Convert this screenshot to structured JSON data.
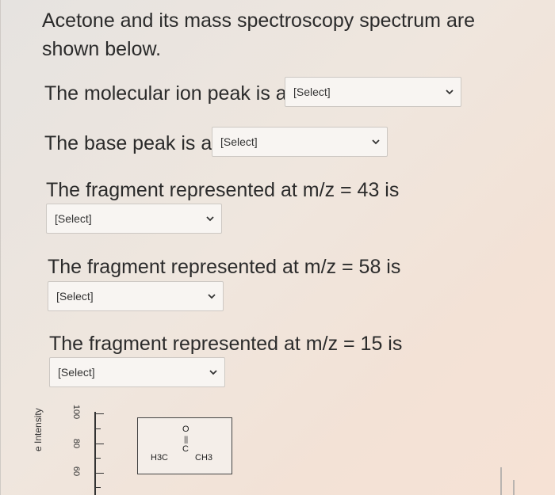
{
  "intro": "Acetone and its mass spectroscopy spectrum are shown below.",
  "questions": [
    {
      "prefix": "The molecular ion peak is at",
      "selected": "[Select]"
    },
    {
      "prefix": "The base peak is at",
      "selected": "[Select]"
    },
    {
      "prefix": "The fragment represented at m/z = 43 is",
      "selected": "[Select]"
    },
    {
      "prefix": "The fragment represented at m/z = 58 is",
      "selected": "[Select]"
    },
    {
      "prefix": "The fragment represented at m/z = 15 is",
      "selected": "[Select]"
    }
  ],
  "spectrum": {
    "y_axis_label": "e Intensity",
    "y_ticks": [
      "100",
      "80",
      "60"
    ]
  },
  "structure": {
    "left_group": "H3C",
    "right_group": "CH3",
    "center": "C",
    "top": "O"
  }
}
